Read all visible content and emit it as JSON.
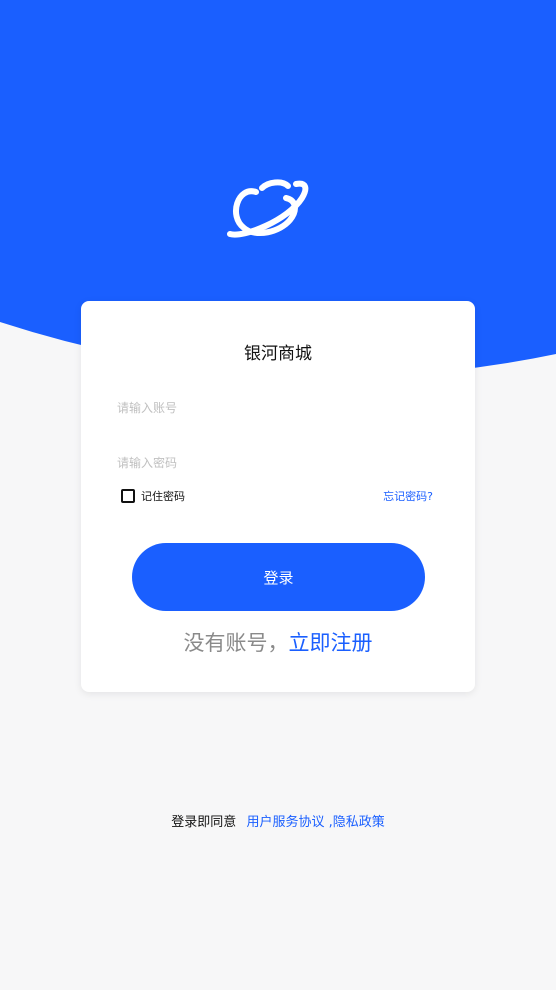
{
  "colors": {
    "brand_blue": "#1a5fff",
    "background": "#f7f7f8",
    "card": "#ffffff"
  },
  "header": {
    "logo_icon": "planet-icon"
  },
  "login_card": {
    "title": "银河商城",
    "account_placeholder": "请输入账号",
    "password_placeholder": "请输入密码",
    "remember_label": "记住密码",
    "remember_checked": false,
    "forgot_label": "忘记密码?",
    "login_label": "登录",
    "no_account_text": "没有账号，",
    "register_label": "立即注册"
  },
  "footer": {
    "agree_text": "登录即同意",
    "agreement_link": "用户服务协议 ,隐私政策"
  }
}
